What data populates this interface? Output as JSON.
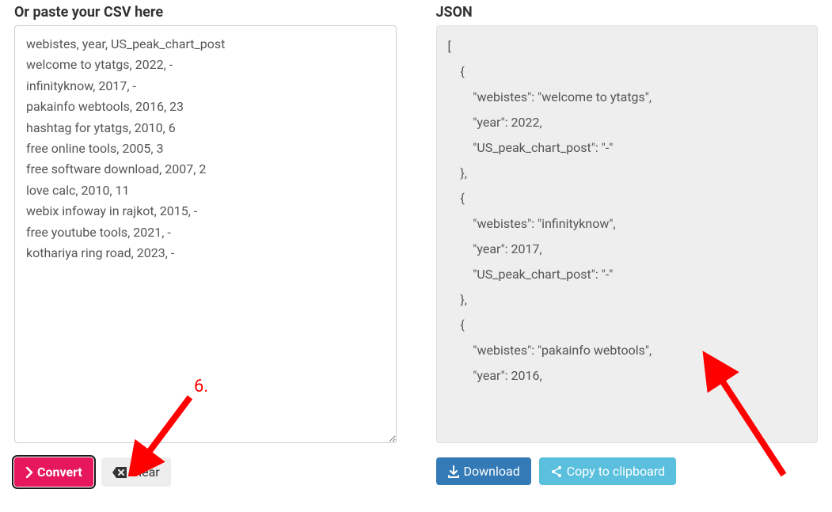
{
  "left": {
    "heading": "Or paste your CSV here",
    "csv_content": "webistes, year, US_peak_chart_post\nwelcome to ytatgs, 2022, -\ninfinityknow, 2017, -\npakainfo webtools, 2016, 23\nhashtag for ytatgs, 2010, 6\nfree online tools, 2005, 3\nfree software download, 2007, 2\nlove calc, 2010, 11\nwebix infoway in rajkot, 2015, -\nfree youtube tools, 2021, -\nkothariya ring road, 2023, -",
    "convert_label": "Convert",
    "clear_label": "Clear"
  },
  "right": {
    "heading": "JSON",
    "json_content": "[\n    {\n        \"webistes\": \"welcome to ytatgs\",\n        \"year\": 2022,\n        \"US_peak_chart_post\": \"-\"\n    },\n    {\n        \"webistes\": \"infinityknow\",\n        \"year\": 2017,\n        \"US_peak_chart_post\": \"-\"\n    },\n    {\n        \"webistes\": \"pakainfo webtools\",\n        \"year\": 2016,",
    "download_label": "Download",
    "copy_label": "Copy to clipboard"
  },
  "annotation": {
    "number": "6."
  }
}
